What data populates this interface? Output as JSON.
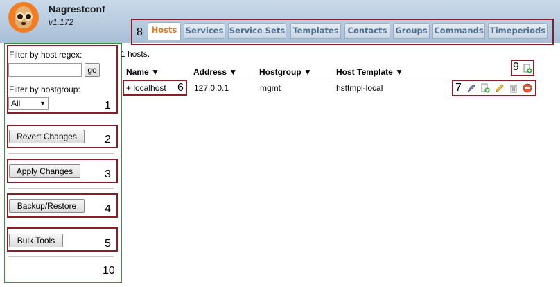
{
  "app": {
    "title": "Nagrestconf",
    "version": "v1.172"
  },
  "tabs": {
    "callout": "8",
    "items": [
      "Hosts",
      "Services",
      "Service Sets",
      "Templates",
      "Contacts",
      "Groups",
      "Commands",
      "Timeperiods"
    ],
    "active_index": 0
  },
  "sidebar": {
    "filter": {
      "host_regex_label": "Filter by host regex:",
      "host_regex_value": "",
      "go_label": "go",
      "hostgroup_label": "Filter by hostgroup:",
      "hostgroup_selected": "All",
      "callout": "1"
    },
    "revert": {
      "label": "Revert Changes",
      "callout": "2"
    },
    "apply": {
      "label": "Apply Changes",
      "callout": "3"
    },
    "backup": {
      "label": "Backup/Restore",
      "callout": "4"
    },
    "bulk": {
      "label": "Bulk Tools",
      "callout": "5"
    },
    "callout": "10"
  },
  "main": {
    "count_text": "1 hosts.",
    "add_callout": "9",
    "columns": [
      "Name ▼",
      "Address ▼",
      "Hostgroup ▼",
      "Host Template ▼"
    ],
    "rows": [
      {
        "name": "+ localhost",
        "address": "127.0.0.1",
        "hostgroup": "mgmt",
        "template": "hsttmpl-local"
      }
    ],
    "name_callout": "6",
    "actions_callout": "7"
  }
}
